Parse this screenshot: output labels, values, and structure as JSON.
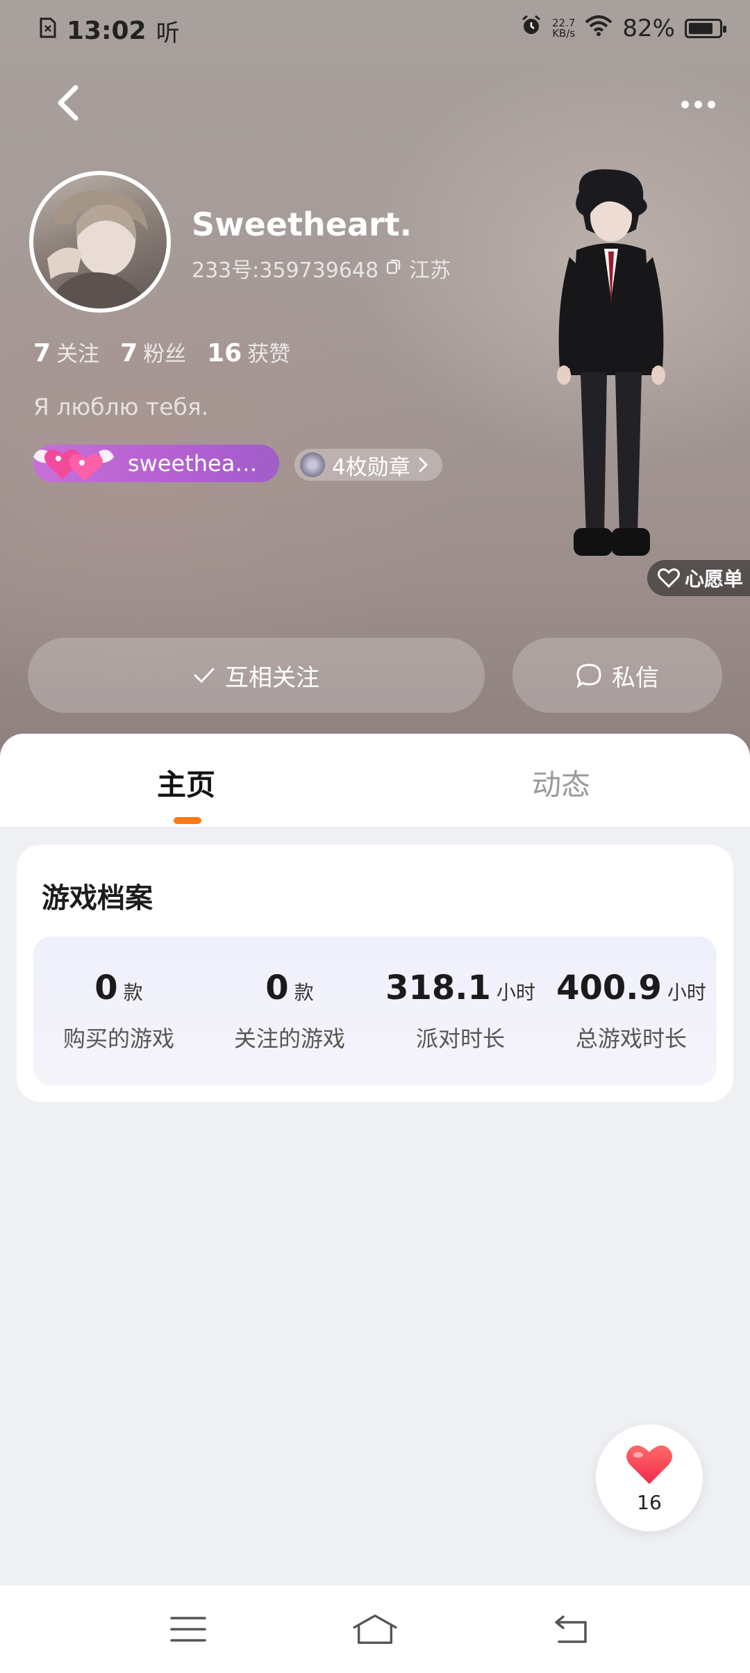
{
  "status_bar": {
    "time": "13:02",
    "extra": "听",
    "net_speed_value": "22.7",
    "net_speed_unit": "KB/s",
    "battery": "82%"
  },
  "profile": {
    "username": "Sweetheart.",
    "user_id": "233号:359739648",
    "location": "江苏",
    "stats": [
      {
        "value": "7",
        "label": "关注"
      },
      {
        "value": "7",
        "label": "粉丝"
      },
      {
        "value": "16",
        "label": "获赞"
      }
    ],
    "bio": "Я люблю тебя.",
    "name_badge_text": "sweethea…",
    "medals_label": "4枚勋章"
  },
  "wishlist_label": "心愿单",
  "actions": {
    "follow_label": "互相关注",
    "message_label": "私信"
  },
  "tabs": [
    {
      "label": "主页",
      "active": true
    },
    {
      "label": "动态",
      "active": false
    }
  ],
  "game_archive": {
    "title": "游戏档案",
    "stats": [
      {
        "value": "0",
        "unit": "款",
        "label": "购买的游戏"
      },
      {
        "value": "0",
        "unit": "款",
        "label": "关注的游戏"
      },
      {
        "value": "318.1",
        "unit": "小时",
        "label": "派对时长"
      },
      {
        "value": "400.9",
        "unit": "小时",
        "label": "总游戏时长"
      }
    ]
  },
  "like": {
    "count": "16"
  },
  "colors": {
    "accent": "#ff7a16",
    "like": "#f24a5a",
    "badge": "#b45fd2"
  }
}
